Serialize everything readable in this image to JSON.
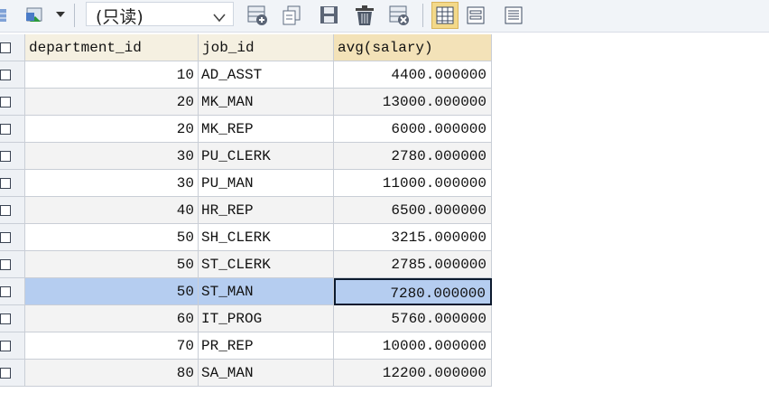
{
  "toolbar": {
    "mode_label": "(只读)",
    "icons": [
      "grid-view-icon",
      "export-icon",
      "dropdown-arrow-icon",
      "mode-dropdown-icon",
      "add-row-icon",
      "copy-row-icon",
      "save-icon",
      "delete-icon",
      "discard-icon",
      "grid-layout-icon",
      "form-layout-icon",
      "text-layout-icon"
    ]
  },
  "grid": {
    "columns": [
      "department_id",
      "job_id",
      "avg(salary)"
    ],
    "rows": [
      {
        "department_id": "10",
        "job_id": "AD_ASST",
        "avg_salary": "4400.000000"
      },
      {
        "department_id": "20",
        "job_id": "MK_MAN",
        "avg_salary": "13000.000000"
      },
      {
        "department_id": "20",
        "job_id": "MK_REP",
        "avg_salary": "6000.000000"
      },
      {
        "department_id": "30",
        "job_id": "PU_CLERK",
        "avg_salary": "2780.000000"
      },
      {
        "department_id": "30",
        "job_id": "PU_MAN",
        "avg_salary": "11000.000000"
      },
      {
        "department_id": "40",
        "job_id": "HR_REP",
        "avg_salary": "6500.000000"
      },
      {
        "department_id": "50",
        "job_id": "SH_CLERK",
        "avg_salary": "3215.000000"
      },
      {
        "department_id": "50",
        "job_id": "ST_CLERK",
        "avg_salary": "2785.000000"
      },
      {
        "department_id": "50",
        "job_id": "ST_MAN",
        "avg_salary": "7280.000000"
      },
      {
        "department_id": "60",
        "job_id": "IT_PROG",
        "avg_salary": "5760.000000"
      },
      {
        "department_id": "70",
        "job_id": "PR_REP",
        "avg_salary": "10000.000000"
      },
      {
        "department_id": "80",
        "job_id": "SA_MAN",
        "avg_salary": "12200.000000"
      }
    ],
    "selected_row": 8
  },
  "colors": {
    "selection": "#b5cdf0",
    "header_sorted": "#f3e2b8",
    "toolbar_bg": "#f1f4f8"
  }
}
